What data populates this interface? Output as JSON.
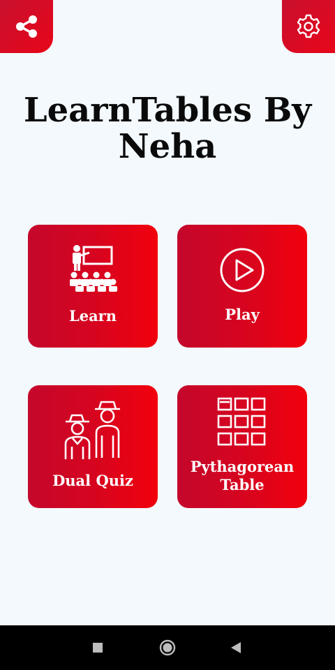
{
  "header": {
    "share_icon": "share-icon",
    "settings_icon": "gear-icon",
    "accent": "#d4061f"
  },
  "app": {
    "title": "LearnTables By Neha"
  },
  "tiles": [
    {
      "label": "Learn",
      "icon": "classroom-teacher-icon"
    },
    {
      "label": "Play",
      "icon": "play-circle-icon"
    },
    {
      "label": "Dual Quiz",
      "icon": "two-cowboys-icon"
    },
    {
      "label": "Pythagorean Table",
      "icon": "grid-table-icon"
    }
  ],
  "navbar": {
    "recents_icon": "square-icon",
    "home_icon": "circle-icon",
    "back_icon": "triangle-back-icon"
  }
}
